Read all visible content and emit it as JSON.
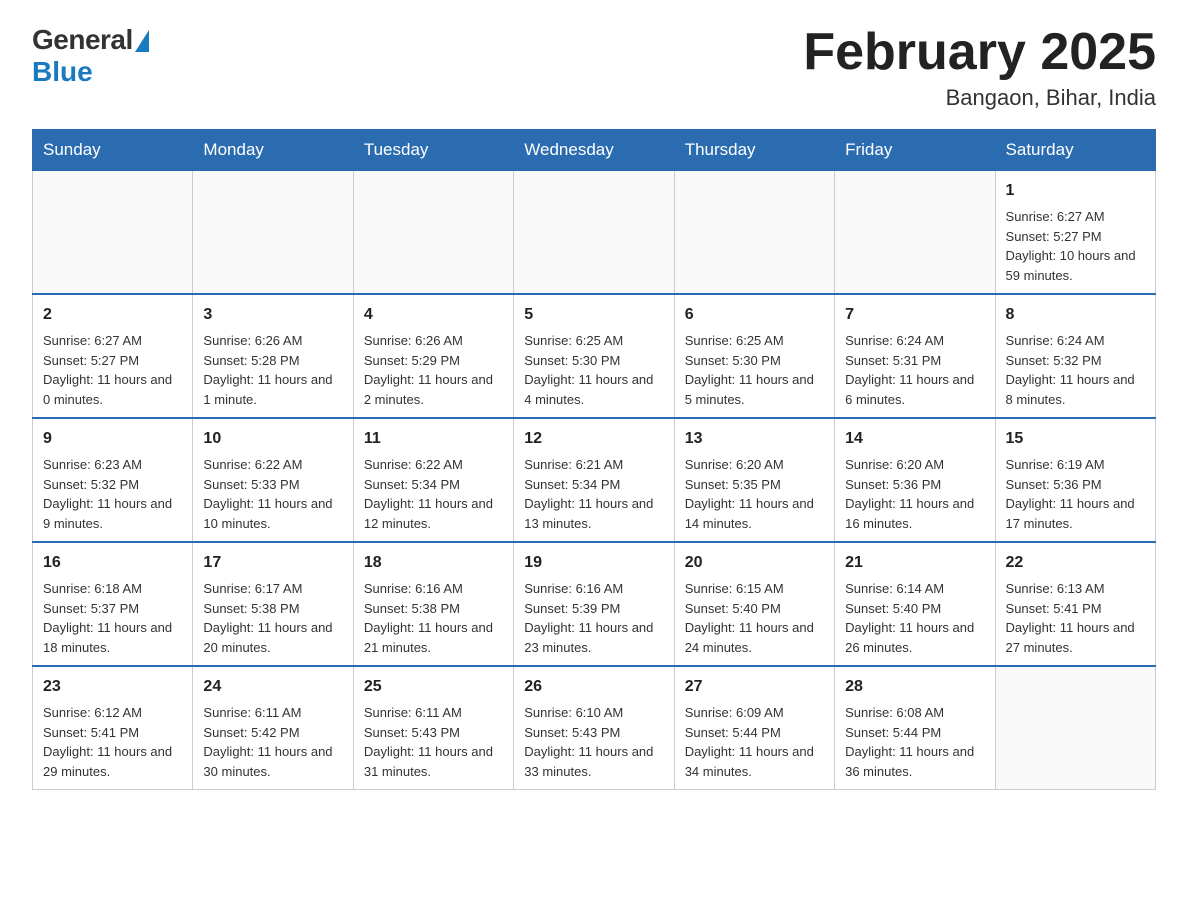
{
  "header": {
    "logo_general": "General",
    "logo_blue": "Blue",
    "title": "February 2025",
    "location": "Bangaon, Bihar, India"
  },
  "weekdays": [
    "Sunday",
    "Monday",
    "Tuesday",
    "Wednesday",
    "Thursday",
    "Friday",
    "Saturday"
  ],
  "weeks": [
    [
      {
        "day": "",
        "info": ""
      },
      {
        "day": "",
        "info": ""
      },
      {
        "day": "",
        "info": ""
      },
      {
        "day": "",
        "info": ""
      },
      {
        "day": "",
        "info": ""
      },
      {
        "day": "",
        "info": ""
      },
      {
        "day": "1",
        "info": "Sunrise: 6:27 AM\nSunset: 5:27 PM\nDaylight: 10 hours and 59 minutes."
      }
    ],
    [
      {
        "day": "2",
        "info": "Sunrise: 6:27 AM\nSunset: 5:27 PM\nDaylight: 11 hours and 0 minutes."
      },
      {
        "day": "3",
        "info": "Sunrise: 6:26 AM\nSunset: 5:28 PM\nDaylight: 11 hours and 1 minute."
      },
      {
        "day": "4",
        "info": "Sunrise: 6:26 AM\nSunset: 5:29 PM\nDaylight: 11 hours and 2 minutes."
      },
      {
        "day": "5",
        "info": "Sunrise: 6:25 AM\nSunset: 5:30 PM\nDaylight: 11 hours and 4 minutes."
      },
      {
        "day": "6",
        "info": "Sunrise: 6:25 AM\nSunset: 5:30 PM\nDaylight: 11 hours and 5 minutes."
      },
      {
        "day": "7",
        "info": "Sunrise: 6:24 AM\nSunset: 5:31 PM\nDaylight: 11 hours and 6 minutes."
      },
      {
        "day": "8",
        "info": "Sunrise: 6:24 AM\nSunset: 5:32 PM\nDaylight: 11 hours and 8 minutes."
      }
    ],
    [
      {
        "day": "9",
        "info": "Sunrise: 6:23 AM\nSunset: 5:32 PM\nDaylight: 11 hours and 9 minutes."
      },
      {
        "day": "10",
        "info": "Sunrise: 6:22 AM\nSunset: 5:33 PM\nDaylight: 11 hours and 10 minutes."
      },
      {
        "day": "11",
        "info": "Sunrise: 6:22 AM\nSunset: 5:34 PM\nDaylight: 11 hours and 12 minutes."
      },
      {
        "day": "12",
        "info": "Sunrise: 6:21 AM\nSunset: 5:34 PM\nDaylight: 11 hours and 13 minutes."
      },
      {
        "day": "13",
        "info": "Sunrise: 6:20 AM\nSunset: 5:35 PM\nDaylight: 11 hours and 14 minutes."
      },
      {
        "day": "14",
        "info": "Sunrise: 6:20 AM\nSunset: 5:36 PM\nDaylight: 11 hours and 16 minutes."
      },
      {
        "day": "15",
        "info": "Sunrise: 6:19 AM\nSunset: 5:36 PM\nDaylight: 11 hours and 17 minutes."
      }
    ],
    [
      {
        "day": "16",
        "info": "Sunrise: 6:18 AM\nSunset: 5:37 PM\nDaylight: 11 hours and 18 minutes."
      },
      {
        "day": "17",
        "info": "Sunrise: 6:17 AM\nSunset: 5:38 PM\nDaylight: 11 hours and 20 minutes."
      },
      {
        "day": "18",
        "info": "Sunrise: 6:16 AM\nSunset: 5:38 PM\nDaylight: 11 hours and 21 minutes."
      },
      {
        "day": "19",
        "info": "Sunrise: 6:16 AM\nSunset: 5:39 PM\nDaylight: 11 hours and 23 minutes."
      },
      {
        "day": "20",
        "info": "Sunrise: 6:15 AM\nSunset: 5:40 PM\nDaylight: 11 hours and 24 minutes."
      },
      {
        "day": "21",
        "info": "Sunrise: 6:14 AM\nSunset: 5:40 PM\nDaylight: 11 hours and 26 minutes."
      },
      {
        "day": "22",
        "info": "Sunrise: 6:13 AM\nSunset: 5:41 PM\nDaylight: 11 hours and 27 minutes."
      }
    ],
    [
      {
        "day": "23",
        "info": "Sunrise: 6:12 AM\nSunset: 5:41 PM\nDaylight: 11 hours and 29 minutes."
      },
      {
        "day": "24",
        "info": "Sunrise: 6:11 AM\nSunset: 5:42 PM\nDaylight: 11 hours and 30 minutes."
      },
      {
        "day": "25",
        "info": "Sunrise: 6:11 AM\nSunset: 5:43 PM\nDaylight: 11 hours and 31 minutes."
      },
      {
        "day": "26",
        "info": "Sunrise: 6:10 AM\nSunset: 5:43 PM\nDaylight: 11 hours and 33 minutes."
      },
      {
        "day": "27",
        "info": "Sunrise: 6:09 AM\nSunset: 5:44 PM\nDaylight: 11 hours and 34 minutes."
      },
      {
        "day": "28",
        "info": "Sunrise: 6:08 AM\nSunset: 5:44 PM\nDaylight: 11 hours and 36 minutes."
      },
      {
        "day": "",
        "info": ""
      }
    ]
  ]
}
